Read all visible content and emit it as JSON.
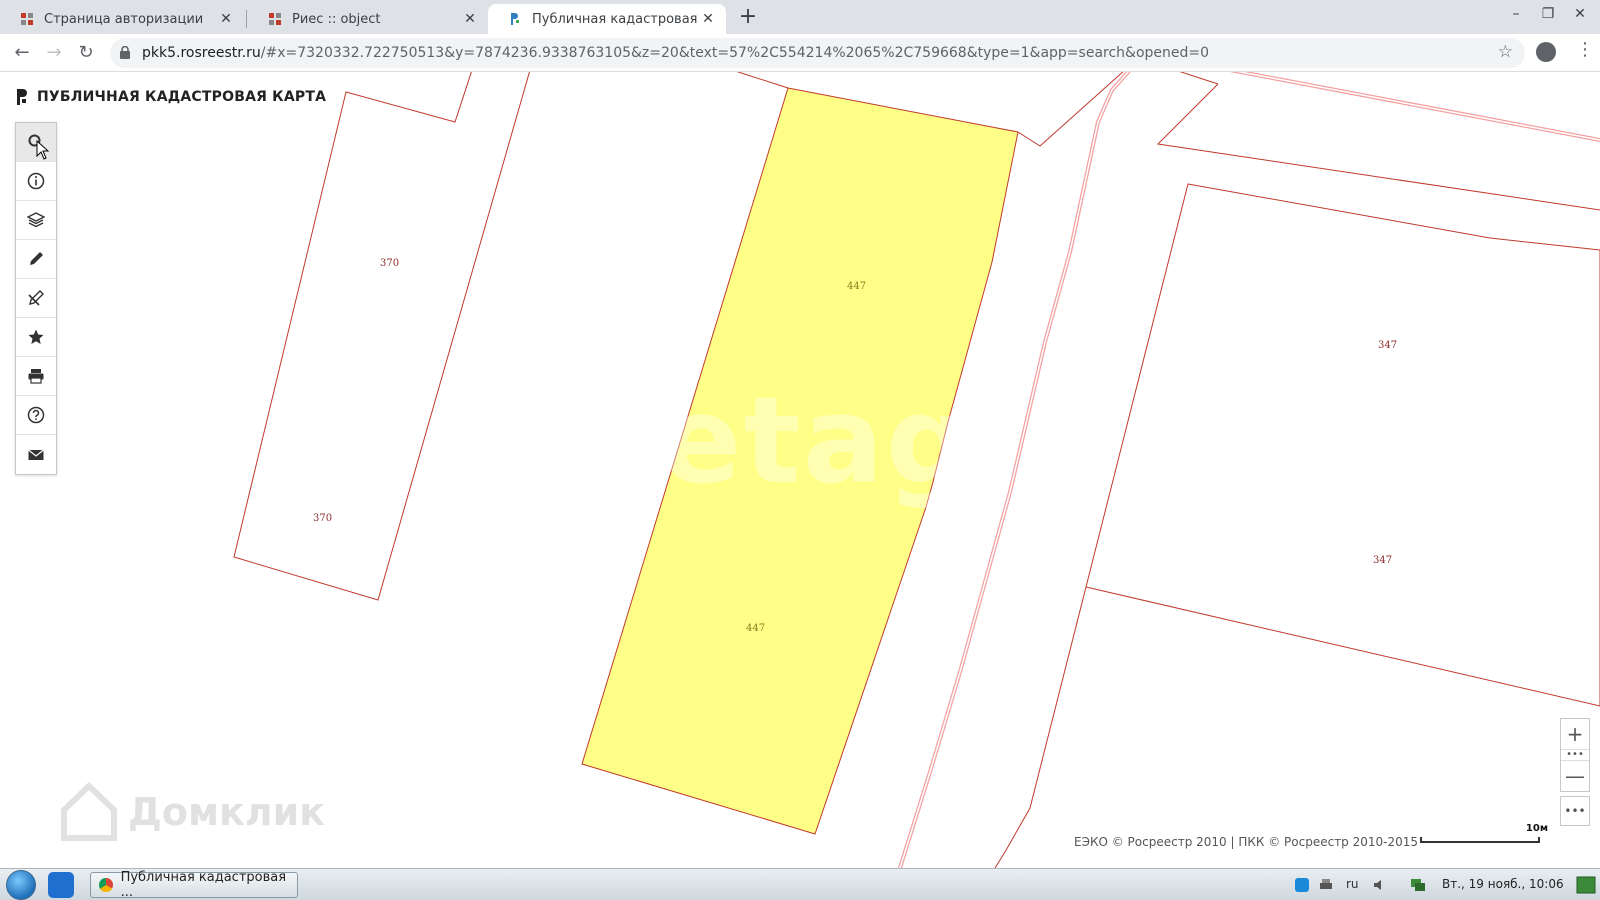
{
  "browser": {
    "tabs": [
      {
        "title": "Страница авторизации",
        "active": false
      },
      {
        "title": "Риес :: object",
        "active": false
      },
      {
        "title": "Публичная кадастровая кар",
        "active": true
      }
    ],
    "url_host": "pkk5.rosreestr.ru",
    "url_rest": "/#x=7320332.722750513&y=7874236.9338763105&z=20&text=57%2C554214%2065%2C759668&type=1&app=search&opened=0",
    "new_tab_symbol": "+",
    "close_symbol": "✕"
  },
  "app": {
    "title": "ПУБЛИЧНАЯ КАДАСТРОВАЯ КАРТА",
    "tools": [
      {
        "name": "search",
        "icon": "search-icon",
        "active": true
      },
      {
        "name": "info",
        "icon": "info-icon",
        "active": false
      },
      {
        "name": "layers",
        "icon": "layers-icon",
        "active": false
      },
      {
        "name": "draw",
        "icon": "pencil-icon",
        "active": false
      },
      {
        "name": "measure",
        "icon": "ruler-pencil-icon",
        "active": false
      },
      {
        "name": "favorites",
        "icon": "star-icon",
        "active": false
      },
      {
        "name": "print",
        "icon": "printer-icon",
        "active": false
      },
      {
        "name": "help",
        "icon": "help-icon",
        "active": false
      },
      {
        "name": "feedback",
        "icon": "mail-icon",
        "active": false
      }
    ]
  },
  "map": {
    "parcel_labels": {
      "left_upper": "370",
      "left_lower": "370",
      "selected_upper": "447",
      "selected_lower": "447",
      "right_upper": "347",
      "right_lower": "347"
    },
    "colors": {
      "parcel_border": "#c0392b",
      "selected_fill": "#ffff88",
      "road_border": "#f4a0a0"
    },
    "watermark": "etagi",
    "domclick_text": "Домклик",
    "zoom_in": "+",
    "zoom_out": "—",
    "zoom_dots": "•••",
    "more": "•••",
    "attribution": "ЕЭКО © Росреестр 2010 | ПКК © Росреестр 2010-2015",
    "scale_label": "10м"
  },
  "taskbar": {
    "active_task": "Публичная кадастровая ...",
    "lang": "ru",
    "clock": "Вт., 19 нояб., 10:06"
  }
}
